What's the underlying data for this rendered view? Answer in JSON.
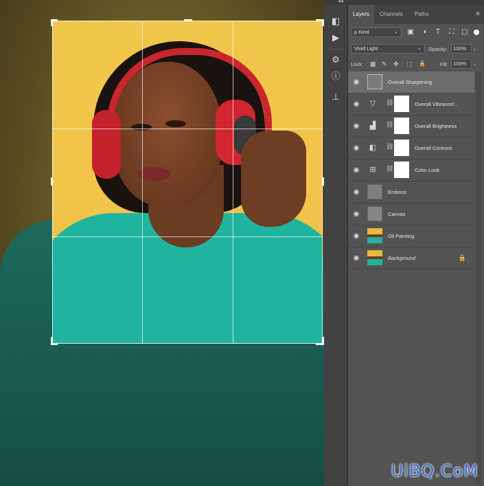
{
  "toolbar_strip": {
    "collapse_glyph": "◂◂",
    "tools": [
      {
        "icon": "color-swatches-icon",
        "glyph": "◧"
      },
      {
        "icon": "play-actions-icon",
        "glyph": "▶"
      },
      {
        "icon": "libraries-icon",
        "glyph": "⚙"
      },
      {
        "icon": "info-icon",
        "glyph": "ⓘ"
      },
      {
        "icon": "clone-source-icon",
        "glyph": "⊥"
      }
    ]
  },
  "panel": {
    "tabs": [
      {
        "label": "Layers",
        "active": true
      },
      {
        "label": "Channels",
        "active": false
      },
      {
        "label": "Paths",
        "active": false
      }
    ],
    "menu_glyph": "≡",
    "filter": {
      "kind_label": "Kind",
      "search_glyph": "ρ",
      "icons": [
        "pixel-filter-icon",
        "adjustment-filter-icon",
        "type-filter-icon",
        "shape-filter-icon",
        "smart-object-filter-icon"
      ],
      "icon_glyphs": [
        "▣",
        "◑",
        "T",
        "⛶",
        "▢"
      ]
    },
    "blend_mode": "Vivid Light",
    "opacity_label": "Opacity:",
    "opacity_value": "100%",
    "lock_label": "Lock:",
    "lock_glyphs": [
      "▦",
      "✎",
      "✥",
      "⬚",
      "🔒"
    ],
    "fill_label": "Fill:",
    "fill_value": "100%",
    "layers": [
      {
        "name": "Overall Sharpening",
        "type": "pixel",
        "selected": true,
        "italic": false
      },
      {
        "name": "Overall Vibrance/...",
        "type": "adjustment",
        "adj_glyph": "▽",
        "selected": false,
        "italic": false
      },
      {
        "name": "Overall Brightness",
        "type": "adjustment",
        "adj_glyph": "▟",
        "selected": false,
        "italic": false
      },
      {
        "name": "Overall Contrast",
        "type": "adjustment",
        "adj_glyph": "◧",
        "selected": false,
        "italic": false
      },
      {
        "name": "Color Look",
        "type": "adjustment",
        "adj_glyph": "⊞",
        "selected": false,
        "italic": false
      },
      {
        "name": "Emboss",
        "type": "pixel",
        "selected": false,
        "italic": false
      },
      {
        "name": "Canvas",
        "type": "pixel",
        "selected": false,
        "italic": false
      },
      {
        "name": "Oil Painting",
        "type": "photo",
        "selected": false,
        "italic": false
      },
      {
        "name": "Background",
        "type": "photo",
        "selected": false,
        "italic": true,
        "locked": true
      }
    ],
    "eye_glyph": "◉",
    "link_glyph": "⛓",
    "lock_glyph": "🔒"
  },
  "watermark": "UiBQ.CoM"
}
